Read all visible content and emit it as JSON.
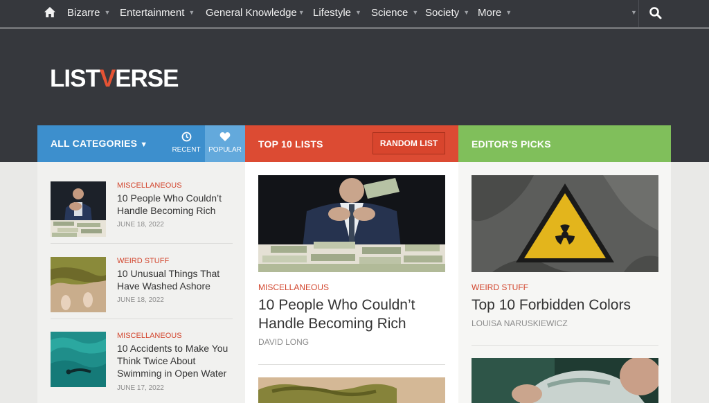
{
  "nav": {
    "items": [
      {
        "label": "Bizarre"
      },
      {
        "label": "Entertainment"
      },
      {
        "label": "General Knowledge"
      },
      {
        "label": "Lifestyle"
      },
      {
        "label": "Science"
      },
      {
        "label": "Society"
      },
      {
        "label": "More"
      }
    ]
  },
  "logo": {
    "part1": "LIST",
    "part2": "V",
    "part3": "ERSE"
  },
  "tabs": {
    "categories": "ALL CATEGORIES",
    "recent": "RECENT",
    "popular": "POPULAR",
    "top10": "TOP 10 LISTS",
    "random": "RANDOM LIST",
    "editors": "EDITOR'S PICKS"
  },
  "sidebar": {
    "items": [
      {
        "category": "MISCELLANEOUS",
        "title": "10 People Who Couldn’t Handle Becoming Rich",
        "date": "JUNE 18, 2022"
      },
      {
        "category": "WEIRD STUFF",
        "title": "10 Unusual Things That Have Washed Ashore",
        "date": "JUNE 18, 2022"
      },
      {
        "category": "MISCELLANEOUS",
        "title": "10 Accidents to Make You Think Twice About Swimming in Open Water",
        "date": "JUNE 17, 2022"
      }
    ]
  },
  "top10": {
    "category": "MISCELLANEOUS",
    "title": "10 People Who Couldn’t Handle Becoming Rich",
    "author": "DAVID LONG"
  },
  "editors": {
    "category": "WEIRD STUFF",
    "title": "Top 10 Forbidden Colors",
    "author": "LOUISA NARUSKIEWICZ"
  },
  "colors": {
    "nav_bg": "#36383d",
    "blue": "#3d8fcd",
    "red": "#dc4b33",
    "green": "#80bf5b",
    "accent": "#d2452d"
  }
}
